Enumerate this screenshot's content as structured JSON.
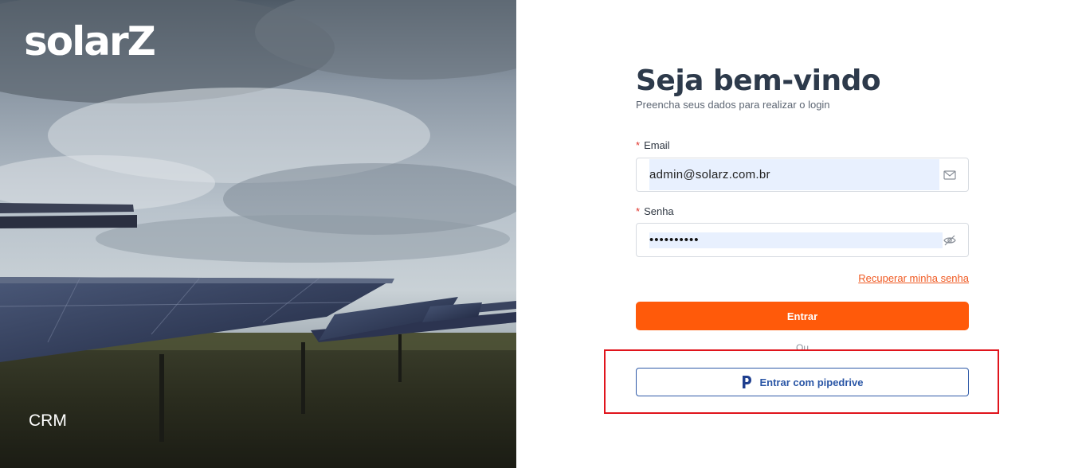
{
  "hero": {
    "logo_text": "solarZ",
    "product_label": "CRM"
  },
  "login": {
    "title": "Seja bem-vindo",
    "subtitle": "Preencha seus dados para realizar o login",
    "email": {
      "required_mark": "*",
      "label": "Email",
      "value": "admin@solarz.com.br",
      "icon": "envelope-icon"
    },
    "password": {
      "required_mark": "*",
      "label": "Senha",
      "masked_value": "••••••••••",
      "icon": "eye-slash-icon"
    },
    "forgot_link": "Recuperar minha senha",
    "submit_label": "Entrar",
    "divider": "Ou",
    "pipedrive_label": "Entrar com pipedrive",
    "pipedrive_icon": "pipedrive-logo-icon"
  },
  "colors": {
    "primary": "#ff5a0a",
    "pipedrive_blue": "#2a56a6",
    "title": "#2d3a4b",
    "required": "#e0342c",
    "annotation_box": "#e0141c"
  }
}
